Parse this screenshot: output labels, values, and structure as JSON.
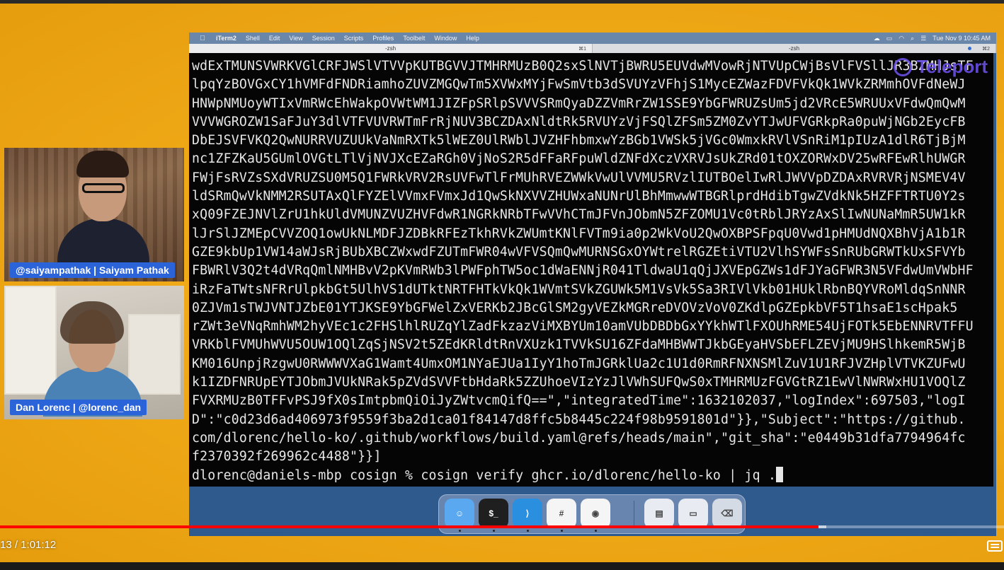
{
  "menubar": {
    "apple": "",
    "app_name": "iTerm2",
    "items": [
      "Shell",
      "Edit",
      "View",
      "Session",
      "Scripts",
      "Profiles",
      "Toolbelt",
      "Window",
      "Help"
    ],
    "clock": "Tue Nov 9  10:45 AM"
  },
  "tabs": [
    {
      "title": "-zsh",
      "shortcut": "⌘1"
    },
    {
      "title": "-zsh",
      "shortcut": "⌘2"
    }
  ],
  "watermark": "Teleport",
  "terminal": {
    "lines": [
      "wdExTMUNSVWRKVGlCRFJWSlVTVVpKUTBGVVJTMHRMUzB0Q2sxSlNVTjBWRU5EUVdwMVowRjNTVUpCWjBsVlFVSllJR3BZMHJsTF",
      "lpqYzBOVGxCY1hVMFdFNDRiamhoZUVZMGQwTm5XVWxMYjFwSmVtb3dSVUYzVFhjS1MycEZWazFDVFVkQk1WVkZRMmhOVFdNeWJ",
      "HNWpNMUoyWTIxVmRWcEhWakpOVWtWM1JIZFpSRlpSVVVSRmQyaDZZVmRrZW1SSE9YbGFWRUZsUm5jd2VRcE5WRUUxVFdwQmQwM",
      "VVVWGROZW1SaFJuY3dlVTFVUVRWTmFrRjNUV3BCZDAxNldtRk5RVUYzVjFSQlZFSm5ZM0ZvYTJwUFVGRkpRa0puWjNGb2EycFB",
      "DbEJSVFVKQ2QwNURRVUZUUkVaNmRXTk5lWEZ0UlRWblJVZHFhbmxwYzBGb1VWSk5jVGc0WmxkRVlVSnRiM1pIUzA1dlR6TjBjM",
      "nc1ZFZKaU5GUmlOVGtLTlVjNVJXcEZaRGh0VjNoS2R5dFFaRFpuWldZNFdXczVXRVJsUkZRd01tOXZORWxDV25wRFEwRlhUWGR",
      "FWjFsRVZsSXdVRUZSU0M5Q1FWRkVRV2RsUVFwTlFrMUhRVEZWWkVwUlVVMU5RVzlIUTBOelIwRlJWVVpDZDAxRVRVRjNSMEV4V",
      "ldSRmQwVkNMM2RSUTAxQlFYZElVVmxFVmxJd1QwSkNXVVZHUWxaNUNrUlBhMmwwWTBGRlprdHdibTgwZVdkNk5HZFFTRTU0Y2s",
      "xQ09FZEJNVlZrU1hkUldVMUNZVUZHVFdwR1NGRkNRbTFwVVhCTmJFVnJObmN5ZFZOMU1Vc0tRblJRYzAxSlIwNUNaMmR5UW1kR",
      "lJrSlJZMEpCVVZOQ1owUkNLMDFJZDBkRFEzTkhRVkZWUmtKNlFVTm9ia0p2WkVoU2QwOXBPSFpqU0Vwd1pHMUdNQXBhVjA1b1R",
      "GZE9kbUp1VW14aWJsRjBUbXBCZWxwdFZUTmFWR04wVFVSQmQwMURNSGxOYWtrelRGZEtiVTU2VlhSYWFsSnRUbGRWTkUxSFVYb",
      "FBWRlV3Q2t4dVRqQmlNMHBvV2pKVmRWb3lPWFphTW5oc1dWaENNjR041TldwaU1qQjJXVEpGZWs1dFJYaGFWR3N5VFdwUmVWbHF",
      "iRzFaTWtsNFRrUlpkbGt5UlhVS1dUTktNRTFHTkVkQk1WVmtSVkZGUWk5M1VsVk5Sa3RIVlVkb01HUklRbnBQYVRoMldqSnNNR",
      "0ZJVm1sTWJVNTJZbE01YTJKSE9YbGFWelZxVERKb2JBcGlSM2gyVEZkMGRreDVOVzVoV0ZKdlpGZEpkbVF5T1hsaE1scHpak5",
      "rZWt3eVNqRmhWM2hyVEc1c2FHSlhlRUZqYlZadFkzazViMXBYUm10amVUbDBDbGxYYkhWTlFXOUhRME54UjFOTk5EbENNRVTFFU",
      "VRKblFVMUhWVU5OUW1OQlZqSjNSV2t5ZEdKRldtRnVXUzk1TVVkSU16ZFdaMHBWWTJkbGEyaHVSbEFLZEVjMU9HSlhkemR5WjB",
      "KM016UnpjRzgwU0RWWWVXaG1Wamt4UmxOM1NYaEJUa1IyY1hoTmJGRklUa2c1U1d0RmRFNXNSMlZuV1U1RFJVZHplVTVKZUFwU",
      "k1IZDFNRUpEYTJObmJVUkNRak5pZVdSVVFtbHdaRk5ZZUhoeVIzYzJlVWhSUFQwS0xTMHRMUzFGVGtRZ1EwVlNWRWxHU1VOQlZ",
      "FVXRMUzB0TFFvPSJ9fX0sImtpbmQiOiJyZWtvcmQifQ==\",\"integratedTime\":1632102037,\"logIndex\":697503,\"logI",
      "D\":\"c0d23d6ad406973f9559f3ba2d1ca01f84147d8ffc5b8445c224f98b9591801d\"}},\"Subject\":\"https://github.",
      "com/dlorenc/hello-ko/.github/workflows/build.yaml@refs/heads/main\",\"git_sha\":\"e0449b31dfa7794964fc",
      "f2370392f269962c4488\"}}]"
    ],
    "prompt": "dlorenc@daniels-mbp cosign % ",
    "command": "cosign verify ghcr.io/dlorenc/hello-ko | jq ."
  },
  "dock": [
    {
      "name": "Finder",
      "icon": "finder-icon",
      "color": "#5aa8f0"
    },
    {
      "name": "Terminal",
      "icon": "terminal-icon",
      "color": "#1f1f1f"
    },
    {
      "name": "Visual Studio Code",
      "icon": "vscode-icon",
      "color": "#2b8fe0"
    },
    {
      "name": "Slack",
      "icon": "slack-icon",
      "color": "#f5f5f5"
    },
    {
      "name": "Chrome",
      "icon": "chrome-icon",
      "color": "#f5f5f5"
    },
    {
      "name": "Downloads",
      "icon": "folder-stack-icon",
      "color": "#e8ecf2"
    },
    {
      "name": "Preview",
      "icon": "preview-icon",
      "color": "#e8ecf2"
    },
    {
      "name": "Trash",
      "icon": "trash-icon",
      "color": "#d5dbe4"
    }
  ],
  "webcams": [
    {
      "label": "@saiyampathak | Saiyam Pathak"
    },
    {
      "label": "Dan Lorenc | @lorenc_dan"
    }
  ],
  "player": {
    "timecode": "13 / 1:01:12",
    "progress_played": 0.815,
    "progress_loaded": 0.823,
    "accent_color": "#ff0000",
    "subtitles_icon": "subtitles-icon"
  }
}
